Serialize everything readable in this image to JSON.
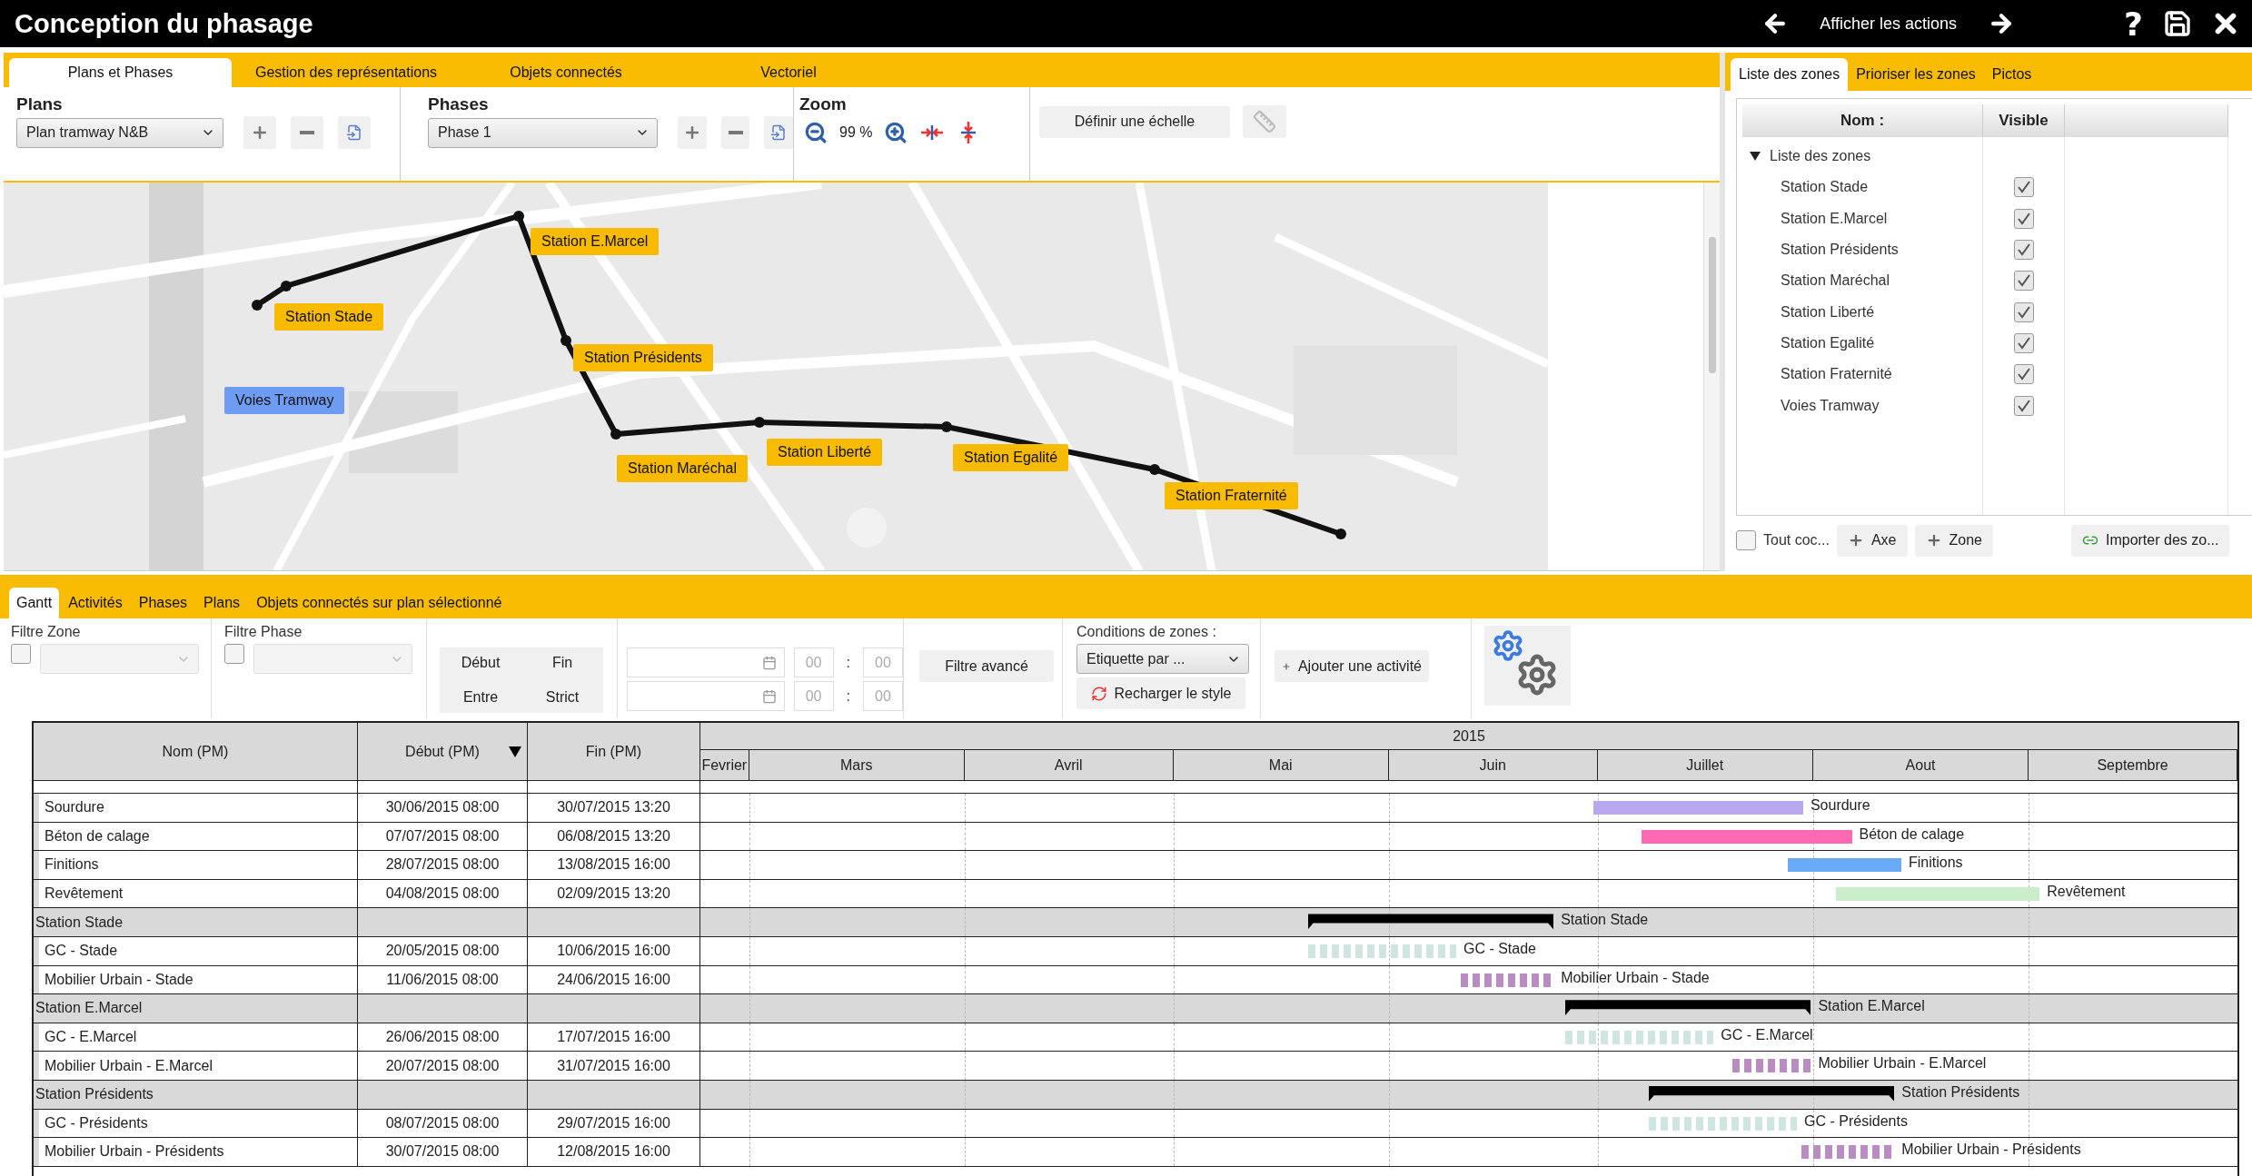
{
  "window": {
    "title": "Conception du phasage",
    "actions_label": "Afficher les actions",
    "help_button": "?"
  },
  "top_tabs": [
    {
      "label": "Plans et Phases",
      "selected": true
    },
    {
      "label": "Gestion des représentations",
      "selected": false
    },
    {
      "label": "Objets connectés",
      "selected": false
    },
    {
      "label": "Vectoriel",
      "selected": false
    }
  ],
  "plans": {
    "label": "Plans",
    "value": "Plan tramway N&B"
  },
  "phases": {
    "label": "Phases",
    "value": "Phase 1"
  },
  "zoom": {
    "label": "Zoom",
    "value": "99 %"
  },
  "scale_button": "Définir une échelle",
  "map": {
    "labels": [
      {
        "text": "Station E.Marcel",
        "color": "#f8bb00"
      },
      {
        "text": "Station Stade",
        "color": "#f8bb00"
      },
      {
        "text": "Station Présidents",
        "color": "#f8bb00"
      },
      {
        "text": "Voies Tramway",
        "color": "#6e9cf2"
      },
      {
        "text": "Station Maréchal",
        "color": "#f8bb00"
      },
      {
        "text": "Station Liberté",
        "color": "#f8bb00"
      },
      {
        "text": "Station Egalité",
        "color": "#f8bb00"
      },
      {
        "text": "Station Fraternité",
        "color": "#f8bb00"
      }
    ]
  },
  "zones_panel": {
    "tabs": [
      {
        "label": "Liste des zones",
        "selected": true
      },
      {
        "label": "Prioriser les zones",
        "selected": false
      },
      {
        "label": "Pictos",
        "selected": false
      }
    ],
    "columns": [
      "Nom :",
      "Visible"
    ],
    "tree": {
      "label": "Liste des zones",
      "expanded": true,
      "children": [
        {
          "label": "Station Stade",
          "visible": true
        },
        {
          "label": "Station E.Marcel",
          "visible": true
        },
        {
          "label": "Station Présidents",
          "visible": true
        },
        {
          "label": "Station Maréchal",
          "visible": true
        },
        {
          "label": "Station Liberté",
          "visible": true
        },
        {
          "label": "Station Egalité",
          "visible": true
        },
        {
          "label": "Station Fraternité",
          "visible": true
        },
        {
          "label": "Voies Tramway",
          "visible": true
        }
      ]
    },
    "check_all": {
      "label": "Tout coc...",
      "checked": false
    },
    "add_buttons": [
      "Axe",
      "Zone"
    ],
    "import_button": "Importer des zo..."
  },
  "bottom_tabs": [
    {
      "label": "Gantt",
      "selected": true
    },
    {
      "label": "Activités",
      "selected": false
    },
    {
      "label": "Phases",
      "selected": false
    },
    {
      "label": "Plans",
      "selected": false
    },
    {
      "label": "Objets connectés sur plan sélectionné",
      "selected": false
    }
  ],
  "filters": {
    "zone": {
      "label": "Filtre Zone",
      "checked": false
    },
    "phase": {
      "label": "Filtre Phase",
      "checked": false
    },
    "mode_buttons": [
      "Début",
      "Fin",
      "Entre",
      "Strict"
    ],
    "time_fields": [
      {
        "hours": {
          "placeholder": "00"
        },
        "minutes": {
          "placeholder": "00"
        }
      },
      {
        "hours": {
          "placeholder": "00"
        },
        "minutes": {
          "placeholder": "00"
        }
      }
    ],
    "time_separator": ":",
    "advanced_button": "Filtre avancé",
    "conditions": {
      "label": "Conditions de zones :",
      "value": "Etiquette par ...",
      "reload_button": "Recharger le style"
    },
    "add_activity_button": "Ajouter une activité"
  },
  "gantt": {
    "columns": [
      {
        "label": "Nom (PM)",
        "sorted": false
      },
      {
        "label": "Début (PM)",
        "sorted": true
      },
      {
        "label": "Fin (PM)",
        "sorted": false
      }
    ],
    "year": "2015",
    "months": [
      "Fevrier",
      "Mars",
      "Avril",
      "Mai",
      "Juin",
      "Juillet",
      "Aout",
      "Septembre"
    ],
    "rows": [
      {
        "kind": "solid",
        "name": "Sourdure",
        "start": "30/06/2015 08:00",
        "end": "30/07/2015 13:20",
        "color": "#b8a8ee",
        "bar_label": "Sourdure"
      },
      {
        "kind": "solid",
        "name": "Béton de calage",
        "start": "07/07/2015 08:00",
        "end": "06/08/2015 13:20",
        "color": "#ff69b4",
        "bar_label": "Béton de calage"
      },
      {
        "kind": "solid",
        "name": "Finitions",
        "start": "28/07/2015 08:00",
        "end": "13/08/2015 16:00",
        "color": "#6aabf7",
        "bar_label": "Finitions"
      },
      {
        "kind": "solid",
        "name": "Revêtement",
        "start": "04/08/2015 08:00",
        "end": "02/09/2015 13:20",
        "color": "#c9eec9",
        "bar_label": "Revêtement"
      },
      {
        "kind": "group",
        "name": "Station Stade",
        "bar_label": "Station Stade"
      },
      {
        "kind": "striped",
        "name": "GC - Stade",
        "start": "20/05/2015 08:00",
        "end": "10/06/2015 16:00",
        "color": "#d0e4e1",
        "bar_label": "GC - Stade"
      },
      {
        "kind": "striped",
        "name": "Mobilier Urbain - Stade",
        "start": "11/06/2015 08:00",
        "end": "24/06/2015 16:00",
        "color": "#b98cc2",
        "bar_label": "Mobilier Urbain - Stade"
      },
      {
        "kind": "group",
        "name": "Station E.Marcel",
        "bar_label": "Station E.Marcel"
      },
      {
        "kind": "striped",
        "name": "GC - E.Marcel",
        "start": "26/06/2015 08:00",
        "end": "17/07/2015 16:00",
        "color": "#d0e4e1",
        "bar_label": "GC - E.Marcel"
      },
      {
        "kind": "striped",
        "name": "Mobilier Urbain - E.Marcel",
        "start": "20/07/2015 08:00",
        "end": "31/07/2015 16:00",
        "color": "#b98cc2",
        "bar_label": "Mobilier Urbain - E.Marcel"
      },
      {
        "kind": "group",
        "name": "Station Présidents",
        "bar_label": "Station Présidents"
      },
      {
        "kind": "striped",
        "name": "GC - Présidents",
        "start": "08/07/2015 08:00",
        "end": "29/07/2015 16:00",
        "color": "#d0e4e1",
        "bar_label": "GC - Présidents"
      },
      {
        "kind": "striped",
        "name": "Mobilier Urbain - Présidents",
        "start": "30/07/2015 08:00",
        "end": "12/08/2015 16:00",
        "color": "#b98cc2",
        "bar_label": "Mobilier Urbain - Présidents"
      }
    ]
  }
}
